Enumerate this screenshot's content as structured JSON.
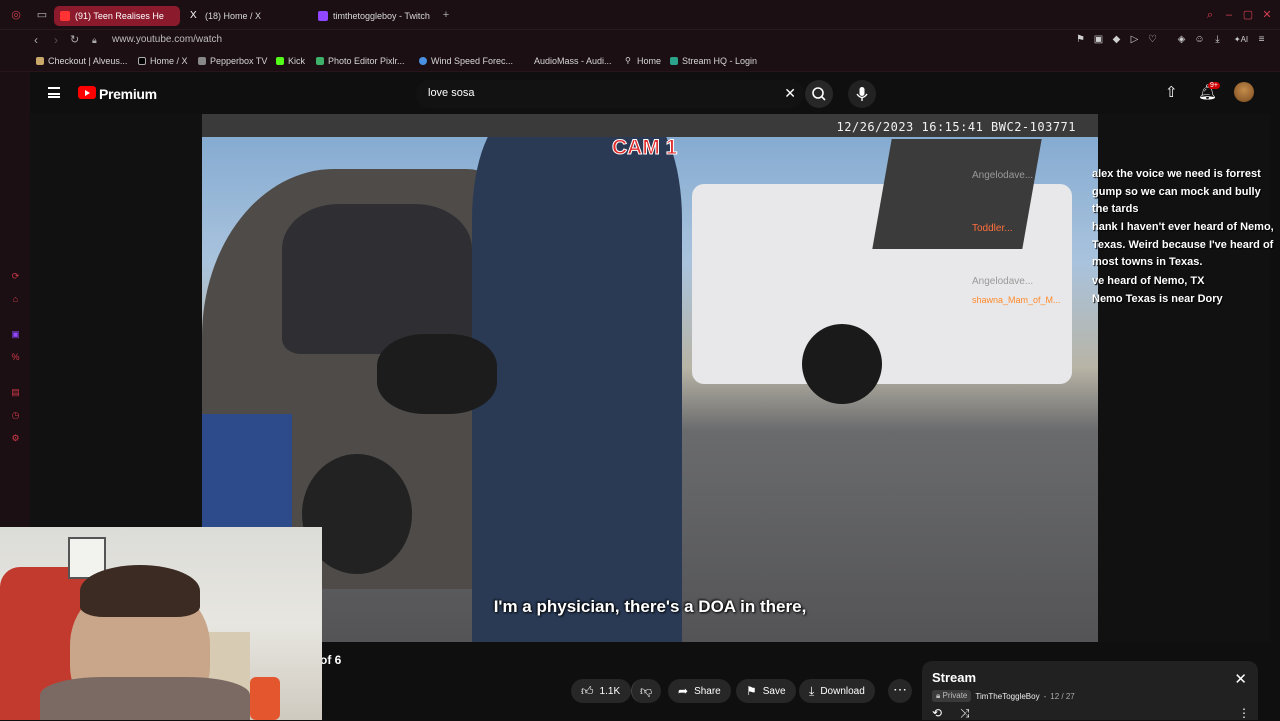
{
  "tabs": [
    {
      "label": "(91) Teen Realises He",
      "active": true
    },
    {
      "label": "(18) Home / X",
      "active": false
    },
    {
      "label": "timthetoggleboy - Twitch",
      "active": false
    }
  ],
  "address": {
    "url": "www.youtube.com/watch"
  },
  "bookmarks": [
    {
      "label": "Checkout | Alveus..."
    },
    {
      "label": "Home / X"
    },
    {
      "label": "Pepperbox TV"
    },
    {
      "label": "Kick"
    },
    {
      "label": "Photo Editor Pixlr..."
    },
    {
      "label": "Wind Speed Forec..."
    },
    {
      "label": "AudioMass - Audi..."
    },
    {
      "label": "Home"
    },
    {
      "label": "Stream HQ - Login"
    }
  ],
  "masthead": {
    "brand": "Premium",
    "search_value": "love sosa",
    "notification_count": "9+"
  },
  "video": {
    "timestamp": "12/26/2023 16:15:41 BWC2-103771",
    "cam_label": "CAM 1",
    "subtitle": "I'm a physician, there's a DOA in there,"
  },
  "chat": {
    "names": [
      "Angelodave...",
      "Toddler...",
      "Angelodave...",
      "shawna_Mam_of_M..."
    ],
    "lines": [
      "alex the voice we need is forrest",
      "gump so we can mock and bully",
      "the tards",
      "hank I haven't ever heard of Nemo,",
      "Texas. Weird because I've heard of",
      "most towns in Texas.",
      "ve heard of Nemo, TX",
      "Nemo Texas is near Dory"
    ]
  },
  "below": {
    "episode_count": "of 6",
    "like_count": "1.1K",
    "share_label": "Share",
    "save_label": "Save",
    "download_label": "Download"
  },
  "playlist": {
    "title": "Stream",
    "privacy": "Private",
    "owner": "TimTheToggleBoy",
    "position": "12 / 27"
  },
  "colors": {
    "accent": "#ff0000",
    "tab_active": "#8b1a2c",
    "cam_label": "#e02828"
  }
}
